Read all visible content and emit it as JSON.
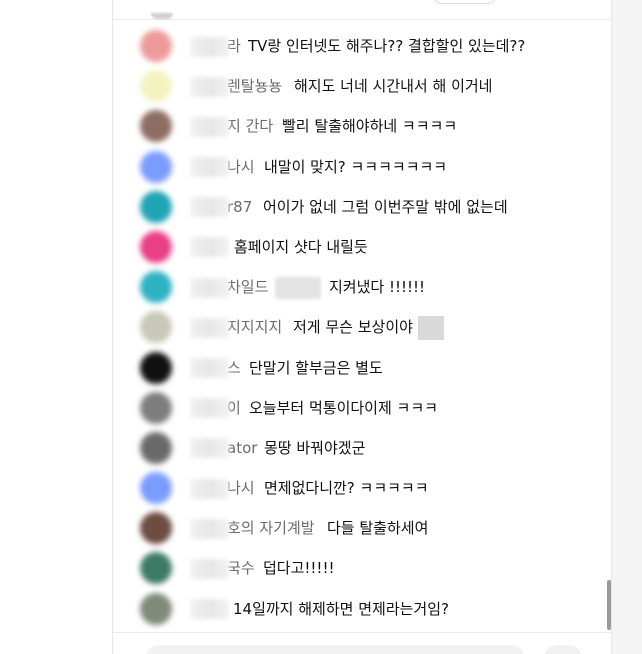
{
  "messages": [
    {
      "name": "라",
      "text": "TV랑 인터넷도 해주나?? 결합할인 있는데??",
      "avatar_color": "#ef9a9a"
    },
    {
      "name": "렌탈뇽뇽",
      "text": "해지도 너네 시간내서 해 이거네",
      "avatar_color": "#f3f3c0"
    },
    {
      "name": "지 간다",
      "text": "빨리 탈출해야하네 ㅋㅋㅋㅋ",
      "avatar_color": "#8d6e63"
    },
    {
      "name": "나시",
      "text": "내말이 맞지? ㅋㅋㅋㅋㅋㅋㅋ",
      "avatar_color": "#7b9cff"
    },
    {
      "name": "r87",
      "text": "어이가 없네 그럼 이번주말 밖에 없는데",
      "avatar_color": "#1fa5b4"
    },
    {
      "name": "",
      "text": "홈페이지 샷다 내릴듯",
      "avatar_color": "#e83f85"
    },
    {
      "name": "차일드",
      "text": "지켜냈다 !!!!!!",
      "avatar_color": "#2fb3c3"
    },
    {
      "name": "지지지지",
      "text": "저게 무슨 보상이야",
      "avatar_color": "#c8c8b8"
    },
    {
      "name": "스",
      "text": "단말기 할부금은 별도",
      "avatar_color": "#111111"
    },
    {
      "name": "이",
      "text": "오늘부터 먹통이다이제 ㅋㅋㅋ",
      "avatar_color": "#7d7d7d"
    },
    {
      "name": "ator",
      "text": "몽땅 바꿔야겠군",
      "avatar_color": "#6a6a6a"
    },
    {
      "name": "나시",
      "text": "면제없다니깐? ㅋㅋㅋㅋㅋ",
      "avatar_color": "#7b9cff"
    },
    {
      "name": "호의 자기계발",
      "text": "다들 탈출하세여",
      "avatar_color": "#6d4c41"
    },
    {
      "name": "국수",
      "text": "덥다고!!!!!",
      "avatar_color": "#3d7a66"
    },
    {
      "name": "",
      "text": "14일까지 해제하면 면제라는거임?",
      "avatar_color": "#7f8a7a"
    }
  ]
}
